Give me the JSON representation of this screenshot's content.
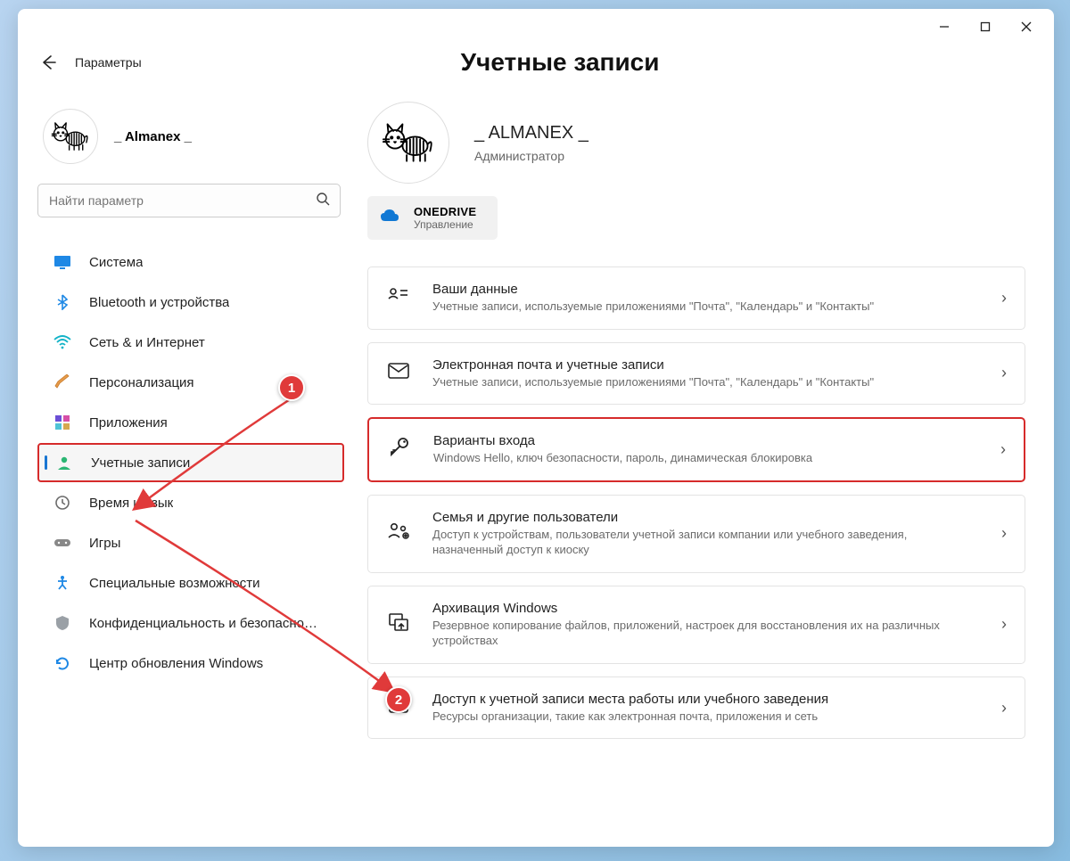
{
  "window": {
    "app_title": "Параметры",
    "page_title": "Учетные записи"
  },
  "sidebar_user": {
    "name": "_ Almanex _"
  },
  "search": {
    "placeholder": "Найти параметр"
  },
  "nav": {
    "system": "Система",
    "bluetooth": "Bluetooth и устройства",
    "network": "Сеть & и Интернет",
    "personalization": "Персонализация",
    "apps": "Приложения",
    "accounts": "Учетные записи",
    "timelang": "Время и язык",
    "gaming": "Игры",
    "accessibility": "Специальные возможности",
    "privacy": "Конфиденциальность и безопасность",
    "update": "Центр обновления Windows"
  },
  "profile": {
    "name": "_ ALMANEX _",
    "role": "Администратор",
    "onedrive_title": "ONEDRIVE",
    "onedrive_sub": "Управление"
  },
  "cards": [
    {
      "title": "Ваши данные",
      "sub": "Учетные записи, используемые приложениями \"Почта\", \"Календарь\" и \"Контакты\""
    },
    {
      "title": "Электронная почта и учетные записи",
      "sub": "Учетные записи, используемые приложениями \"Почта\", \"Календарь\" и \"Контакты\""
    },
    {
      "title": "Варианты входа",
      "sub": "Windows Hello, ключ безопасности, пароль, динамическая блокировка"
    },
    {
      "title": "Семья и другие пользователи",
      "sub": "Доступ к устройствам, пользователи учетной записи компании или учебного заведения, назначенный доступ к киоску"
    },
    {
      "title": "Архивация Windows",
      "sub": "Резервное копирование файлов, приложений, настроек для восстановления их на различных устройствах"
    },
    {
      "title": "Доступ к учетной записи места работы или учебного заведения",
      "sub": "Ресурсы организации, такие как электронная почта, приложения и сеть"
    }
  ],
  "annotations": {
    "badge1": "1",
    "badge2": "2"
  }
}
